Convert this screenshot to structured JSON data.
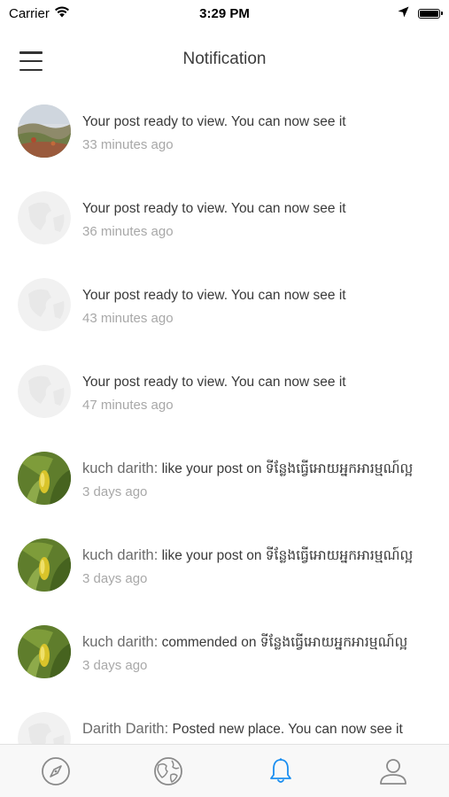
{
  "status_bar": {
    "carrier": "Carrier",
    "time": "3:29 PM",
    "wifi_icon": "wifi-icon",
    "location_icon": "location-arrow-icon",
    "battery_icon": "battery-icon"
  },
  "nav": {
    "title": "Notification",
    "menu_icon": "hamburger-menu-icon"
  },
  "notifications": [
    {
      "avatar": "landscape-photo",
      "name": "",
      "message": "Your post ready to view. You can now see it",
      "time": "33 minutes ago"
    },
    {
      "avatar": "placeholder-globe",
      "name": "",
      "message": "Your post ready to view. You can now see it",
      "time": "36 minutes ago"
    },
    {
      "avatar": "placeholder-globe",
      "name": "",
      "message": "Your post ready to view. You can now see it",
      "time": "43 minutes ago"
    },
    {
      "avatar": "placeholder-globe",
      "name": "",
      "message": "Your post ready to view. You can now see it",
      "time": "47 minutes ago"
    },
    {
      "avatar": "plant-photo",
      "name": "kuch darith:",
      "message": " like your post on ទីន្លែងធ្វើអោយអ្នកអារម្មណ៍ល្អ",
      "time": "3 days ago"
    },
    {
      "avatar": "plant-photo",
      "name": "kuch darith:",
      "message": " like your post on ទីន្លែងធ្វើអោយអ្នកអារម្មណ៍ល្អ",
      "time": "3 days ago"
    },
    {
      "avatar": "plant-photo",
      "name": "kuch darith:",
      "message": " commended on ទីន្លែងធ្វើអោយអ្នកអារម្មណ៍ល្អ",
      "time": "3 days ago"
    },
    {
      "avatar": "placeholder-globe",
      "name": "Darith Darith:",
      "message": " Posted new place. You can now see it",
      "time": ""
    }
  ],
  "tab_bar": {
    "tabs": [
      {
        "icon": "compass-icon",
        "active": false
      },
      {
        "icon": "globe-icon",
        "active": false
      },
      {
        "icon": "bell-icon",
        "active": true
      },
      {
        "icon": "profile-icon",
        "active": false
      }
    ],
    "active_color": "#1a8ef0",
    "inactive_color": "#8a8a8a"
  }
}
